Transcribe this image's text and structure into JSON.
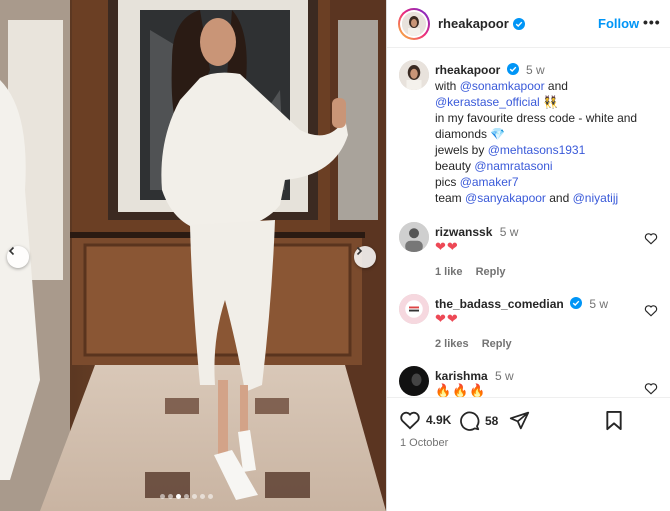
{
  "post": {
    "username": "rheakapoor",
    "follow_label": "Follow",
    "more_label": "•••",
    "caption": {
      "username": "rheakapoor",
      "time": "5 w",
      "lines": [
        {
          "pre": "with ",
          "mention": "@sonamkapoor",
          "post": " and"
        },
        {
          "pre": "",
          "mention": "@kerastase_official",
          "post": " 👯"
        },
        {
          "pre": "in my favourite dress code - white and diamonds 💎",
          "mention": "",
          "post": ""
        },
        {
          "pre": "jewels by ",
          "mention": "@mehtasons1931",
          "post": ""
        },
        {
          "pre": "beauty ",
          "mention": "@namratasoni",
          "post": ""
        },
        {
          "pre": "pics ",
          "mention": "@amaker7",
          "post": ""
        },
        {
          "pre": "team ",
          "mention": "@sanyakapoor",
          "post": " and ",
          "mention2": "@niyatijj"
        }
      ]
    },
    "comments": [
      {
        "username": "rizwanssk",
        "time": "5 w",
        "text": "❤❤",
        "likes": "1 like",
        "reply": "Reply",
        "verified": false
      },
      {
        "username": "the_badass_comedian",
        "time": "5 w",
        "text": "❤❤",
        "likes": "2 likes",
        "reply": "Reply",
        "verified": true
      },
      {
        "username": "karishma",
        "time": "5 w",
        "text": "🔥🔥🔥",
        "verified": false
      }
    ],
    "like_count": "4.9K",
    "comment_count": "58",
    "date": "1 October",
    "carousel": {
      "count": 7,
      "active_index": 2
    }
  },
  "colors": {
    "accent": "#0095f6",
    "mention": "#3a5ad9",
    "heart": "#ed4956",
    "muted": "#737373"
  }
}
